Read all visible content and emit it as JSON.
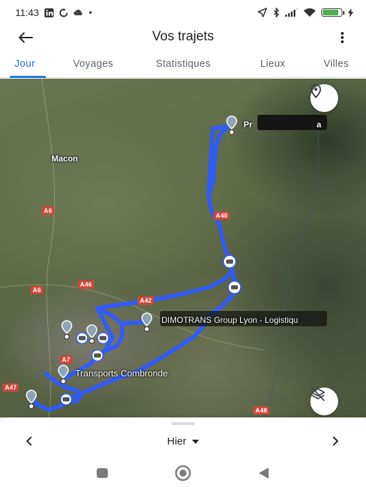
{
  "status_bar": {
    "time": "11:43",
    "battery_level": 0.85,
    "icons": [
      "linkedin-icon",
      "sync-icon",
      "cloud-icon",
      "dot-icon",
      "location-arrow-icon",
      "bluetooth-icon",
      "signal-icon",
      "wifi-icon",
      "battery-icon",
      "charging-icon"
    ]
  },
  "app_bar": {
    "title": "Vos trajets",
    "back_icon": "arrow-left-icon",
    "more_icon": "more-vert-icon"
  },
  "tabs": [
    {
      "label": "Jour",
      "active": true
    },
    {
      "label": "Voyages",
      "active": false
    },
    {
      "label": "Statistiques",
      "active": false
    },
    {
      "label": "Lieux",
      "active": false
    },
    {
      "label": "Villes",
      "active": false
    }
  ],
  "map": {
    "city_labels": {
      "macon": "Macon"
    },
    "place_labels": {
      "top_right": "Pr",
      "top_right_suffix": "a",
      "dimotrans": "DIMOTRANS Group Lyon - Logistiqu",
      "combronde": "Transports Combronde"
    },
    "roads": {
      "a6_north": "A6",
      "a40": "A40",
      "a46": "A46",
      "a6_south": "A6",
      "a42": "A42",
      "a7": "A7",
      "a47": "A47",
      "a48": "A48"
    },
    "route_color": "#2f5bff",
    "location_button_icon": "location-pin-icon",
    "layers_button_icon": "layers-off-icon"
  },
  "bottom_sheet": {
    "date_label": "Hier",
    "prev_icon": "chevron-left-icon",
    "next_icon": "chevron-right-icon",
    "dropdown_icon": "dropdown-triangle-icon"
  },
  "system_nav": {
    "buttons": [
      "recents-square-icon",
      "home-circle-icon",
      "back-triangle-icon"
    ]
  }
}
